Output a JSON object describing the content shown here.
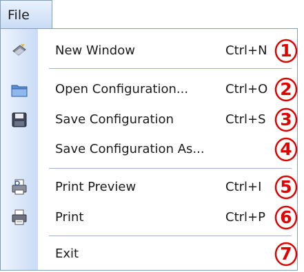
{
  "menubar": {
    "file_label": "File"
  },
  "menu": {
    "items": [
      {
        "label": "New Window",
        "shortcut": "Ctrl+N",
        "icon": "new-window-icon",
        "callout": "1"
      },
      {
        "label": "Open Configuration...",
        "shortcut": "Ctrl+O",
        "icon": "folder-open-icon",
        "callout": "2"
      },
      {
        "label": "Save Configuration",
        "shortcut": "Ctrl+S",
        "icon": "floppy-disk-icon",
        "callout": "3"
      },
      {
        "label": "Save Configuration As...",
        "shortcut": "",
        "icon": "",
        "callout": "4"
      },
      {
        "label": "Print Preview",
        "shortcut": "Ctrl+I",
        "icon": "print-preview-icon",
        "callout": "5"
      },
      {
        "label": "Print",
        "shortcut": "Ctrl+P",
        "icon": "printer-icon",
        "callout": "6"
      },
      {
        "label": "Exit",
        "shortcut": "",
        "icon": "",
        "callout": "7"
      }
    ]
  },
  "colors": {
    "callout": "#e00000",
    "gutter": "#c9dbf4",
    "border": "#7f9db9"
  }
}
